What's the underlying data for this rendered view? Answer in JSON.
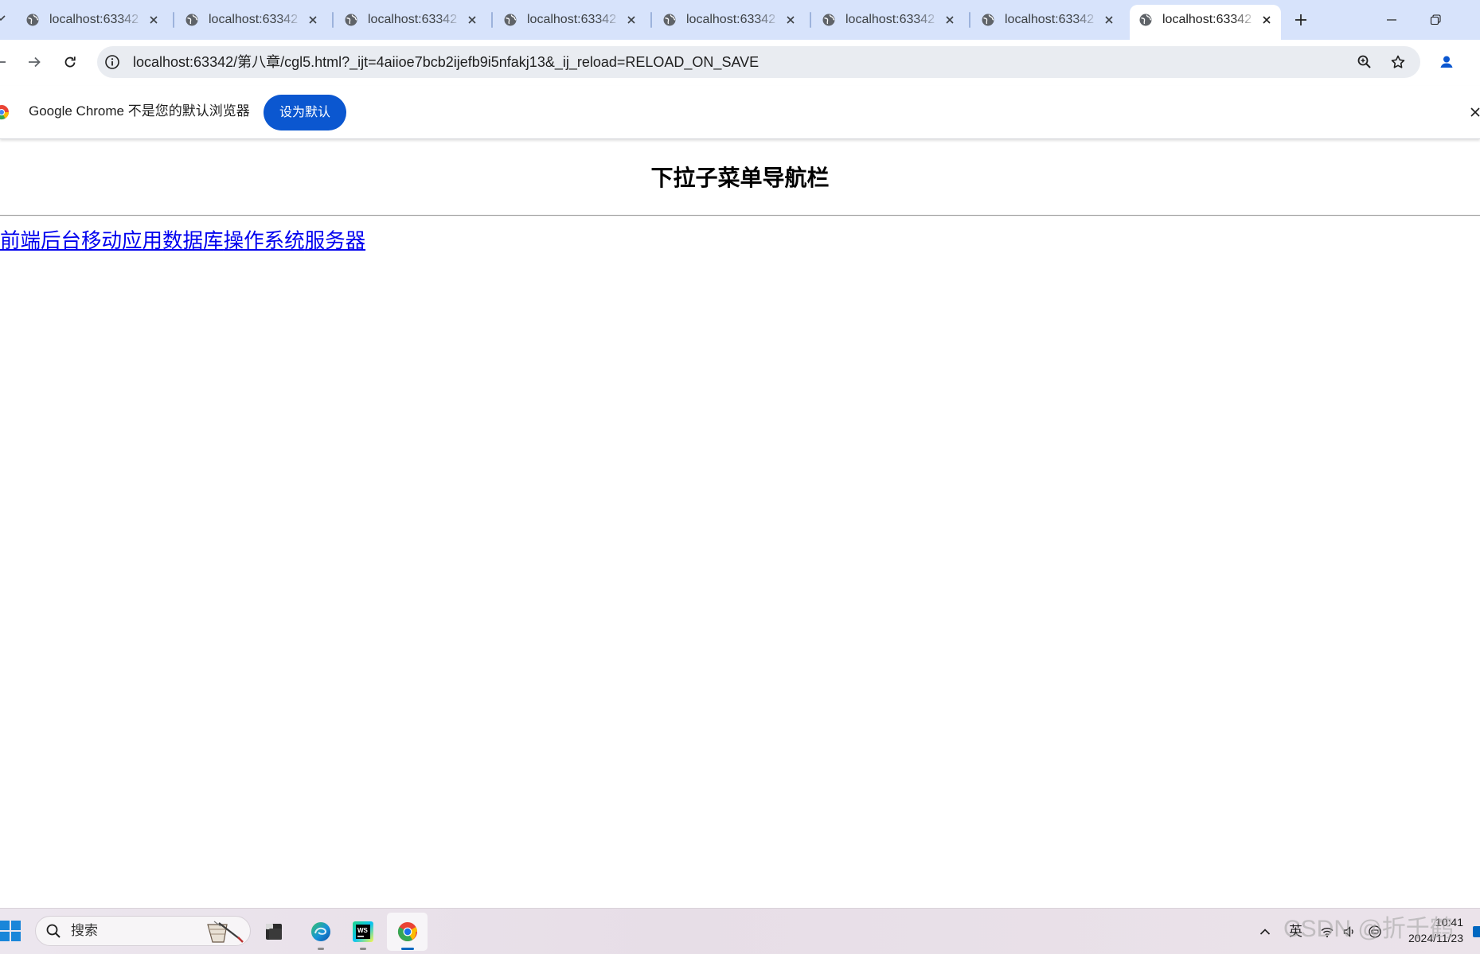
{
  "browser": {
    "tabs": [
      {
        "title": "localhost:63342",
        "active": false
      },
      {
        "title": "localhost:63342",
        "active": false
      },
      {
        "title": "localhost:63342",
        "active": false
      },
      {
        "title": "localhost:63342",
        "active": false
      },
      {
        "title": "localhost:63342",
        "active": false
      },
      {
        "title": "localhost:63342",
        "active": false
      },
      {
        "title": "localhost:63342",
        "active": false
      },
      {
        "title": "localhost:63342",
        "active": true
      }
    ],
    "address": {
      "url": "localhost:63342/第八章/cgl5.html?_ijt=4aiioe7bcb2ijefb9i5nfakj13&_ij_reload=RELOAD_ON_SAVE"
    },
    "infobar": {
      "message": "Google Chrome 不是您的默认浏览器",
      "button_label": "设为默认"
    },
    "icons": [
      "tab-list-icon",
      "globe-icon",
      "close-icon",
      "plus-icon",
      "minimize-icon",
      "restore-icon",
      "back-arrow-icon",
      "forward-arrow-icon",
      "reload-icon",
      "info-icon",
      "zoom-icon",
      "star-icon",
      "profile-icon",
      "chrome-logo-icon"
    ]
  },
  "page": {
    "title": "下拉子菜单导航栏",
    "nav": [
      {
        "label": "前端"
      },
      {
        "label": "后台"
      },
      {
        "label": "移动应用"
      },
      {
        "label": "数据库"
      },
      {
        "label": "操作系统"
      },
      {
        "label": "服务器"
      }
    ]
  },
  "taskbar": {
    "search_placeholder": "搜索",
    "apps": [
      {
        "name": "task-view-icon"
      },
      {
        "name": "edge-icon"
      },
      {
        "name": "webstorm-icon",
        "logo_text": "WS"
      },
      {
        "name": "chrome-icon",
        "active": true
      }
    ],
    "tray": {
      "ime": "英",
      "time": "10:41",
      "date": "2024/11/23"
    }
  },
  "watermark": "CSDN @折千鹤",
  "colors": {
    "tabstrip": "#d7e3fb",
    "omnibox": "#e9ecf1",
    "primary_button": "#0b57d0",
    "link": "#0000ee",
    "taskbar_accent": "#0067c0"
  }
}
